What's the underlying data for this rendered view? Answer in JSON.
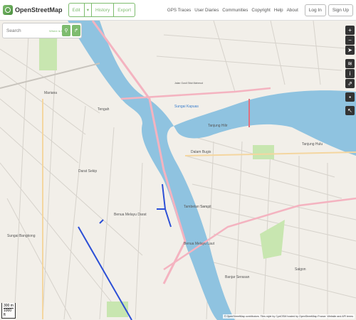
{
  "header": {
    "logo_text": "OpenStreetMap",
    "edit_label": "Edit",
    "edit_caret": "▾",
    "history_label": "History",
    "export_label": "Export",
    "nav": [
      "GPS Traces",
      "User Diaries",
      "Communities",
      "Copyright",
      "Help",
      "About"
    ],
    "login_label": "Log In",
    "signup_label": "Sign Up"
  },
  "search": {
    "placeholder": "Search",
    "where_am_i": "Where is this?"
  },
  "map_labels": {
    "mariana": "Mariana",
    "tengah": "Tengah",
    "darat_sekip": "Darat Sekip",
    "benua_melayu_darat": "Benua Melayu\nDarat",
    "sungai_bangkong": "Sungai Bangkong",
    "tanjung_hilir": "Tanjung Hilir",
    "dalam_bugis": "Dalam Bugis",
    "tanjung_hulu": "Tanjung Hulu",
    "tambelan_sampit": "Tambelan Sampit",
    "benua_melayu_laut": "Benua Melayu\nLaut",
    "banjar_serasan": "Banjar Serasan",
    "saigon": "Saigon",
    "river_name": "Sungai Kapuas",
    "gusti_road": "Jalan Gusti Situt Mahmud"
  },
  "controls": [
    "zoom-in",
    "zoom-out",
    "locate",
    "layers",
    "info",
    "share",
    "note",
    "query"
  ],
  "scale": {
    "metric": "300 m",
    "imperial": "1000 ft"
  },
  "attribution": "© OpenStreetMap contributors. Tiles style by CyclOSM hosted by OpenStreetMap France. Website and API terms",
  "colors": {
    "accent": "#7ebc6f",
    "water": "#aad3df",
    "river": "#8fc3e0",
    "land": "#f2efe9",
    "road_pink": "#f4b3c0",
    "road_gray": "#c8c4bd",
    "control_bg": "#333333"
  }
}
